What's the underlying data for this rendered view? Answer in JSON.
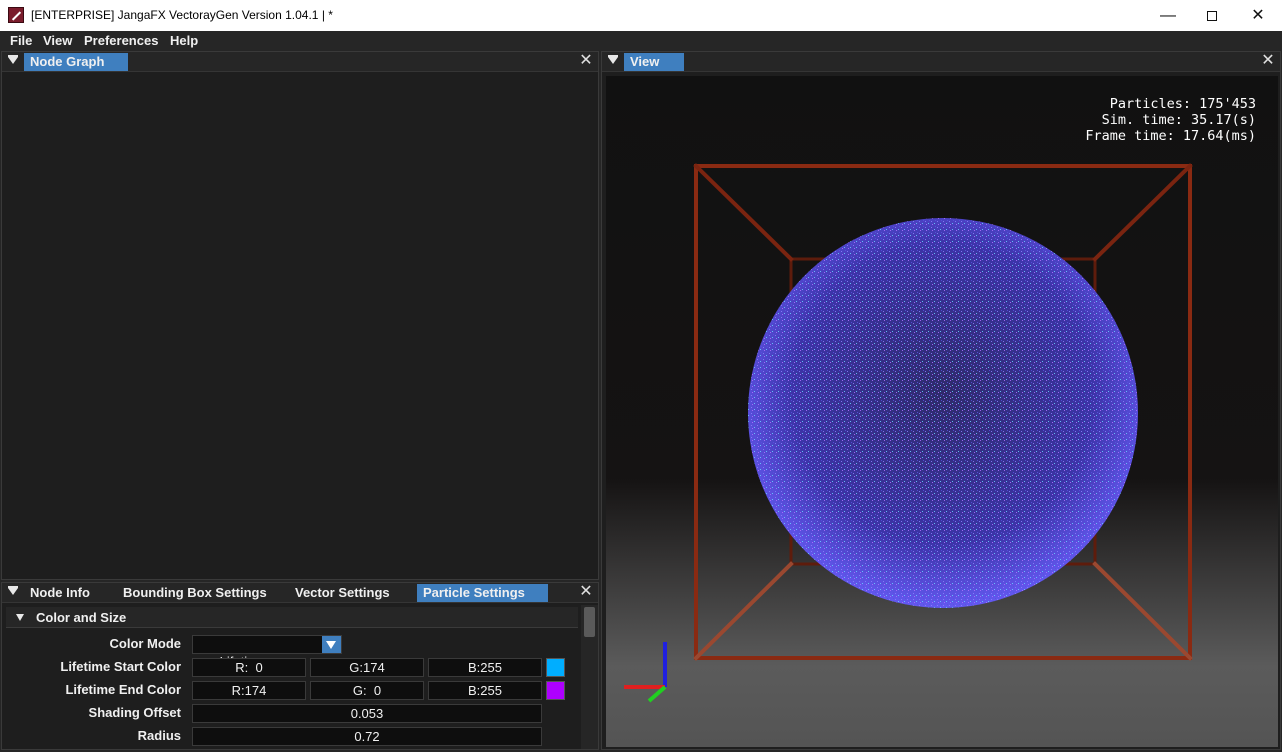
{
  "window": {
    "title": "[ENTERPRISE] JangaFX VectorayGen Version 1.04.1 | *",
    "minimize_glyph": "—",
    "close_glyph": "✕"
  },
  "menu": [
    "File",
    "View",
    "Preferences",
    "Help"
  ],
  "node_graph_panel": {
    "tab": "Node Graph",
    "close_glyph": "✕"
  },
  "view_panel": {
    "tab": "View",
    "close_glyph": "✕",
    "stats": {
      "particles": "Particles: 175'453",
      "sim_time": "Sim. time: 35.17(s)",
      "frame_time": "Frame time: 17.64(ms)"
    },
    "colors": {
      "bounding_box": "#8a2a12",
      "sphere": "#5a4ee8",
      "axis_x": "#e02020",
      "axis_y": "#2020e0",
      "axis_z": "#20d020"
    }
  },
  "settings_panel": {
    "tabs": [
      "Node Info",
      "Bounding Box Settings",
      "Vector Settings",
      "Particle Settings"
    ],
    "active_tab": 3,
    "close_glyph": "✕",
    "section": "Color and Size",
    "color_mode": {
      "label": "Color Mode",
      "value": "Lifetime"
    },
    "lifetime_start_color": {
      "label": "Lifetime Start Color",
      "r": "R:  0",
      "g": "G:174",
      "b": "B:255",
      "swatch": "#00aeff"
    },
    "lifetime_end_color": {
      "label": "Lifetime End Color",
      "r": "R:174",
      "g": "G:  0",
      "b": "B:255",
      "swatch": "#ae00ff"
    },
    "shading_offset": {
      "label": "Shading Offset",
      "value": "0.053"
    },
    "radius": {
      "label": "Radius",
      "value": "0.72"
    }
  }
}
